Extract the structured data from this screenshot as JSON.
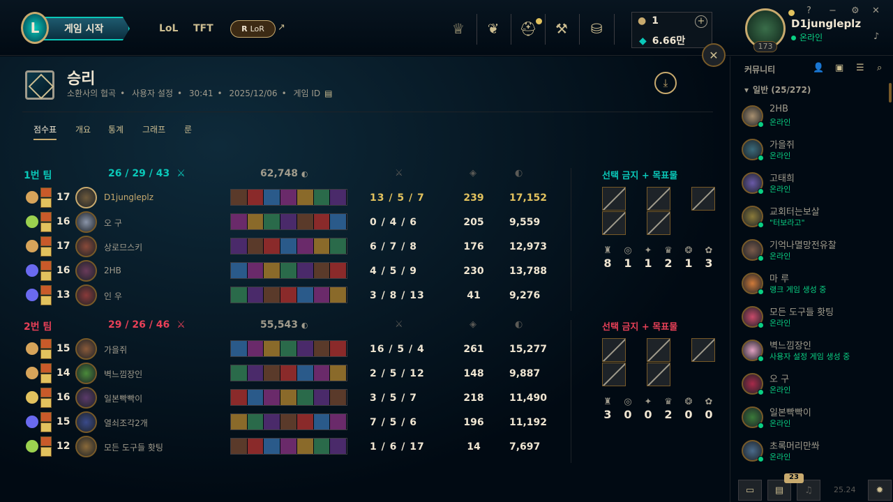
{
  "topbar": {
    "play_label": "게임 시작",
    "tab_lol": "LoL",
    "tab_tft": "TFT",
    "lor_label": "LoR",
    "rp": "1",
    "be": "6.66만",
    "username": "D1jungleplz",
    "status": "온라인",
    "level": "173"
  },
  "match": {
    "result": "승리",
    "map": "소환사의 협곡",
    "mode": "사용자 설정",
    "duration": "30:41",
    "date": "2025/12/06",
    "game_id_label": "게임 ID"
  },
  "tabs": [
    "점수표",
    "개요",
    "통계",
    "그래프",
    "룬"
  ],
  "bans_title": "선택 금지 + 목표물",
  "teams": [
    {
      "name": "1번 팀",
      "kills": "26",
      "deaths": "29",
      "assists": "43",
      "gold": "62,748",
      "color": "#0ac8b9",
      "objectives": [
        "8",
        "1",
        "1",
        "2",
        "1",
        "3"
      ],
      "players": [
        {
          "level": "17",
          "name": "D1jungleplz",
          "kda": "13 / 5 / 7",
          "cs": "239",
          "gold": "17,152",
          "self": true,
          "rune": "#d7a45a",
          "champ": "#6e5a3c"
        },
        {
          "level": "16",
          "name": "오 구",
          "kda": "0 / 4 / 6",
          "cs": "205",
          "gold": "9,559",
          "rune": "#9bd14f",
          "champ": "#8a94a8"
        },
        {
          "level": "17",
          "name": "상로므스키",
          "kda": "6 / 7 / 8",
          "cs": "176",
          "gold": "12,973",
          "rune": "#d7a45a",
          "champ": "#8a4a3a"
        },
        {
          "level": "16",
          "name": "2HB",
          "kda": "4 / 5 / 9",
          "cs": "230",
          "gold": "13,788",
          "rune": "#6a6af0",
          "champ": "#6a3a5a"
        },
        {
          "level": "13",
          "name": "인 우",
          "kda": "3 / 8 / 13",
          "cs": "41",
          "gold": "9,276",
          "rune": "#6a6af0",
          "champ": "#8a3a3a"
        }
      ]
    },
    {
      "name": "2번 팀",
      "kills": "29",
      "deaths": "26",
      "assists": "46",
      "gold": "55,543",
      "color": "#e84057",
      "objectives": [
        "3",
        "0",
        "0",
        "2",
        "0",
        "0"
      ],
      "players": [
        {
          "level": "15",
          "name": "가을쥐",
          "kda": "16 / 5 / 4",
          "cs": "261",
          "gold": "15,277",
          "rune": "#d7a45a",
          "champ": "#8a5a3a"
        },
        {
          "level": "14",
          "name": "벽느낌장인",
          "kda": "2 / 5 / 12",
          "cs": "148",
          "gold": "9,887",
          "rune": "#d7a45a",
          "champ": "#4a8a3a"
        },
        {
          "level": "16",
          "name": "일본빡빡이",
          "kda": "3 / 5 / 7",
          "cs": "218",
          "gold": "11,490",
          "rune": "#e2c25e",
          "champ": "#5a3a6a"
        },
        {
          "level": "15",
          "name": "열쇠조각2개",
          "kda": "7 / 5 / 6",
          "cs": "196",
          "gold": "11,192",
          "rune": "#6a6af0",
          "champ": "#3a4a8a"
        },
        {
          "level": "12",
          "name": "모든 도구들 홧팅",
          "kda": "1 / 6 / 17",
          "cs": "14",
          "gold": "7,697",
          "rune": "#9bd14f",
          "champ": "#8a6a3a"
        }
      ]
    }
  ],
  "social": {
    "title": "커뮤니티",
    "group": "일반 (25/272)",
    "friends": [
      {
        "name": "2HB",
        "status": "온라인",
        "c": "#a89070"
      },
      {
        "name": "가을쥐",
        "status": "온라인",
        "c": "#3a6a7a"
      },
      {
        "name": "고태희",
        "status": "온라인",
        "c": "#6a5aa8"
      },
      {
        "name": "교회터는보살",
        "status": "\"터보라고\"",
        "c": "#8a7a3a"
      },
      {
        "name": "기억나멸망전유찰",
        "status": "온라인",
        "c": "#7a5a4a"
      },
      {
        "name": "마 루",
        "status": "랭크 게임 생성 중",
        "c": "#d07a3a"
      },
      {
        "name": "모든 도구들 홧팅",
        "status": "온라인",
        "c": "#c84a6a"
      },
      {
        "name": "벽느낌장인",
        "status": "사용자 설정 게임 생성 중",
        "c": "#e0a0c0"
      },
      {
        "name": "오 구",
        "status": "온라인",
        "c": "#a82a4a"
      },
      {
        "name": "일본빡빡이",
        "status": "온라인",
        "c": "#3a7a3a"
      },
      {
        "name": "초록머리만쏴",
        "status": "온라인",
        "c": "#4a6a8a"
      }
    ],
    "badge": "23",
    "time": "25.24"
  }
}
